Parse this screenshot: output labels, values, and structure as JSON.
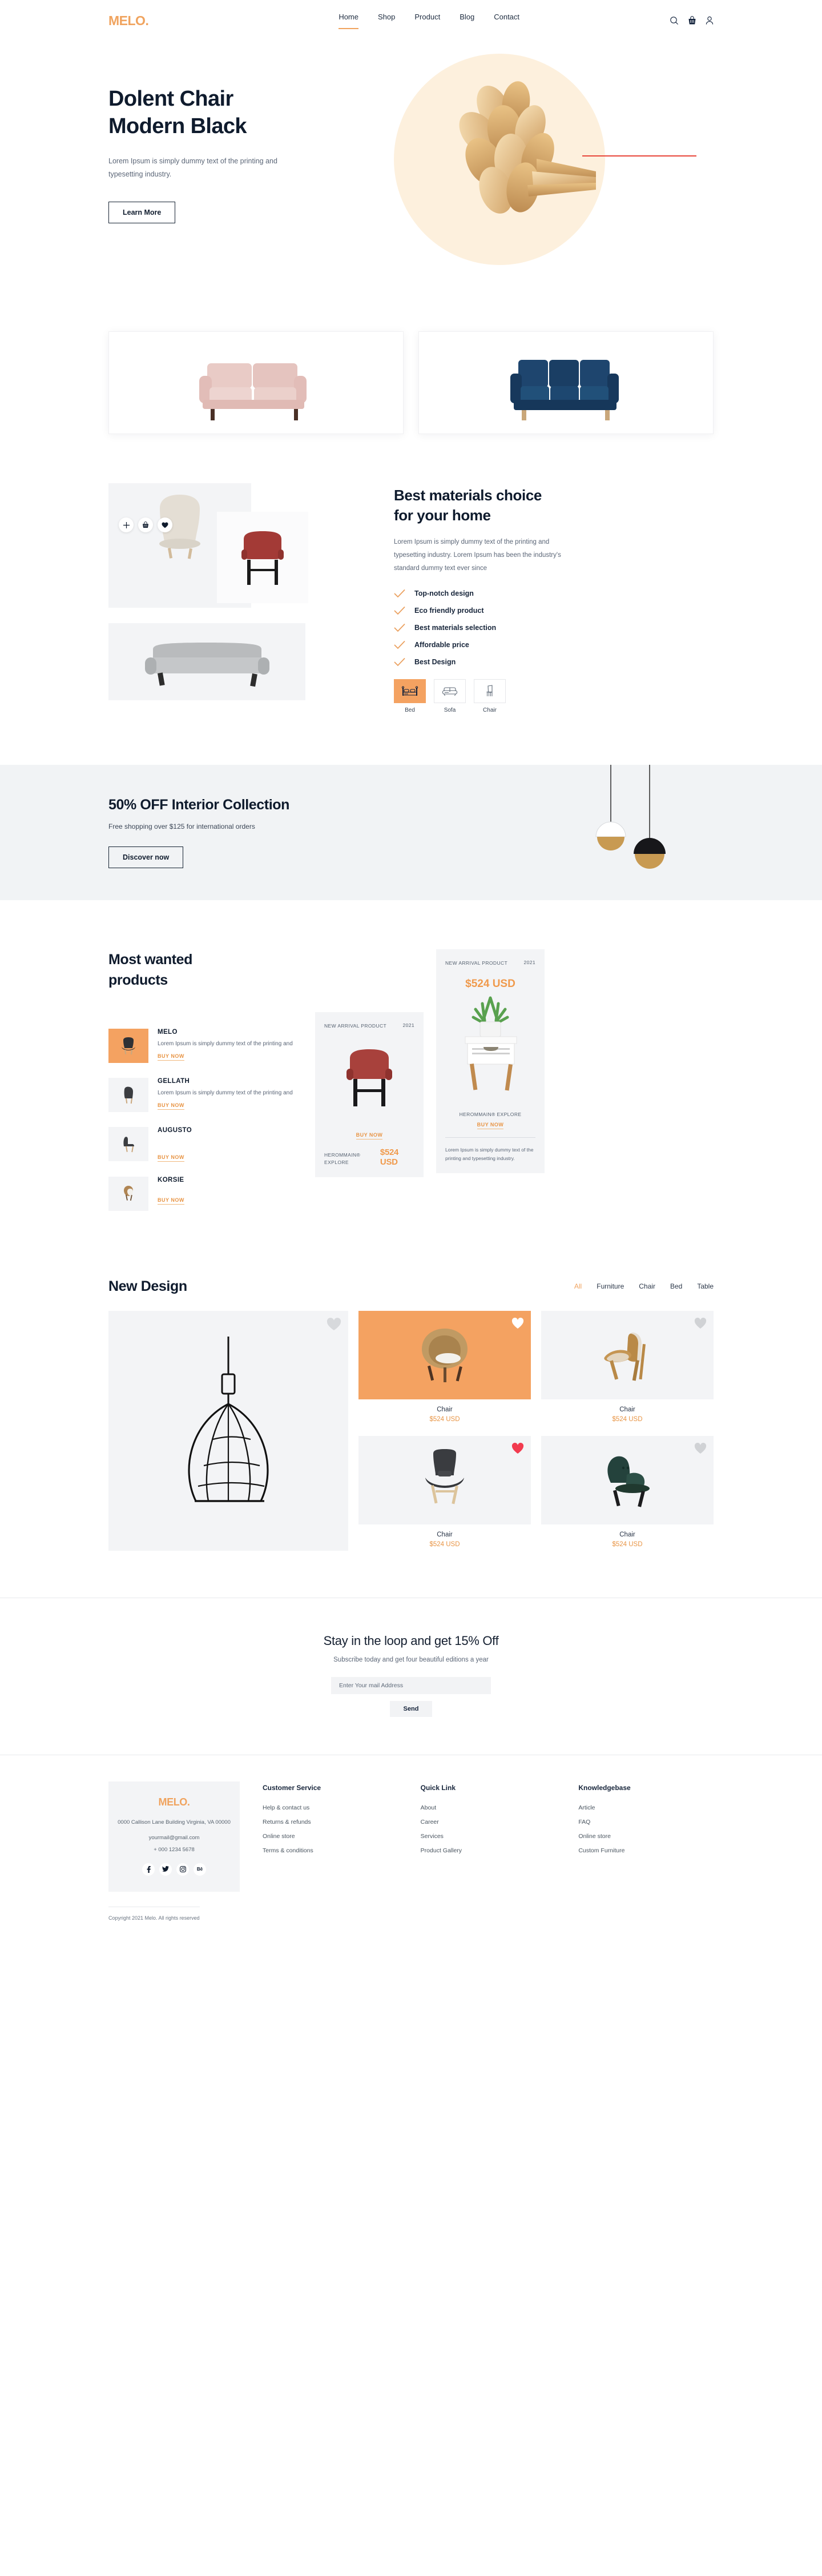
{
  "brand": {
    "name": "MELO",
    "dot": "."
  },
  "nav": {
    "items": [
      {
        "label": "Home",
        "active": true
      },
      {
        "label": "Shop",
        "active": false
      },
      {
        "label": "Product",
        "active": false
      },
      {
        "label": "Blog",
        "active": false
      },
      {
        "label": "Contact",
        "active": false
      }
    ],
    "icons": [
      "search-icon",
      "cart-icon",
      "account-icon"
    ]
  },
  "hero": {
    "title_line1": "Dolent Chair",
    "title_line2": "Modern Black",
    "subtitle": "Lorem Ipsum is simply dummy text of the printing and typesetting industry.",
    "cta": "Learn More",
    "accent_circle": "#fdf0dd",
    "accent_line": "#e8463a"
  },
  "sofas": [
    {
      "name": "pink-sofa",
      "color": "#e3c0bb"
    },
    {
      "name": "navy-sofa",
      "color": "#1e456e"
    }
  ],
  "materials": {
    "title_line1": "Best materials choice",
    "title_line2": "for your home",
    "description": "Lorem Ipsum is simply dummy text of the printing and typesetting industry. Lorem Ipsum has been the industry's standard dummy text ever since",
    "features": [
      "Top-notch design",
      "Eco friendly product",
      "Best materials selection",
      "Affordable price",
      "Best Design"
    ],
    "actions": [
      "plus-icon",
      "basket-icon",
      "heart-icon"
    ],
    "categories": [
      {
        "label": "Bed",
        "icon": "bed-icon",
        "active": true
      },
      {
        "label": "Sofa",
        "icon": "sofa-icon",
        "active": false
      },
      {
        "label": "Chair",
        "icon": "chair-icon",
        "active": false
      }
    ],
    "check_color": "#eba160"
  },
  "promo": {
    "title": "50% OFF Interior Collection",
    "subtitle": "Free shopping over $125 for international orders",
    "cta": "Discover now",
    "background": "#f1f3f5"
  },
  "wanted": {
    "title_line1": "Most wanted",
    "title_line2": "products",
    "items": [
      {
        "name": "MELO",
        "desc": "Lorem Ipsum is simply dummy text of the printing and",
        "buy": "BUY NOW",
        "highlight": true
      },
      {
        "name": "GELLATH",
        "desc": "Lorem Ipsum is simply dummy text of the printing and",
        "buy": "BUY NOW",
        "highlight": false
      },
      {
        "name": "AUGUSTO",
        "desc": "",
        "buy": "BUY NOW",
        "highlight": false
      },
      {
        "name": "KORSIE",
        "desc": "",
        "buy": "BUY NOW",
        "highlight": false
      }
    ],
    "card_chair": {
      "badge": "NEW ARRIVAL PRODUCT",
      "year": "2021",
      "buy": "BUY NOW",
      "brand": "HEROMMAIN® EXPLORE",
      "price": "$524 USD"
    },
    "card_table": {
      "badge": "NEW ARRIVAL PRODUCT",
      "year": "2021",
      "price": "$524 USD",
      "brand": "HEROMMAIN® EXPLORE",
      "buy": "BUY NOW",
      "note": "Lorem Ipsum is simply dummy text of the printing and typesetting industry."
    }
  },
  "newdesign": {
    "title": "New Design",
    "tabs": [
      {
        "label": "All",
        "active": true
      },
      {
        "label": "Furniture",
        "active": false
      },
      {
        "label": "Chair",
        "active": false
      },
      {
        "label": "Bed",
        "active": false
      },
      {
        "label": "Table",
        "active": false
      }
    ],
    "featured": {
      "name": "pendant-lamp"
    },
    "products": [
      {
        "name": "Chair",
        "price": "$524 USD",
        "bg": "orange",
        "heart": "white",
        "img": "rattan-chair"
      },
      {
        "name": "Chair",
        "price": "$524 USD",
        "bg": "grey",
        "heart": "grey",
        "img": "shell-chair"
      },
      {
        "name": "Chair",
        "price": "$524 USD",
        "bg": "grey",
        "heart": "red",
        "img": "dark-lounge-chair"
      },
      {
        "name": "Chair",
        "price": "$524 USD",
        "bg": "grey",
        "heart": "grey",
        "img": "green-armchair"
      }
    ]
  },
  "newsletter": {
    "title": "Stay in the loop and get 15% Off",
    "subtitle": "Subscribe today and get four beautiful editions a year",
    "placeholder": "Enter Your mail Address",
    "value": "",
    "button": "Send"
  },
  "footer": {
    "logo": "MELO.",
    "address": "0000 Callison Lane Building Virginia, VA 00000",
    "email": "yourmail@gmail.com",
    "phone": "+ 000 1234 5678",
    "social": [
      "facebook-icon",
      "twitter-icon",
      "instagram-icon",
      "behance-icon"
    ],
    "columns": [
      {
        "heading": "Customer Service",
        "links": [
          "Help & contact us",
          "Returns & refunds",
          "Online store",
          "Terms & conditions"
        ]
      },
      {
        "heading": "Quick Link",
        "links": [
          "About",
          "Career",
          "Services",
          "Product Gallery"
        ]
      },
      {
        "heading": "Knowledgebase",
        "links": [
          "Article",
          "FAQ",
          "Online store",
          "Custom Furniture"
        ]
      }
    ],
    "copyright": "Copyright 2021 Melo. All rights reserved"
  },
  "colors": {
    "accent": "#f0a35e",
    "dark": "#0f1b2d",
    "grey_bg": "#f3f4f6"
  }
}
